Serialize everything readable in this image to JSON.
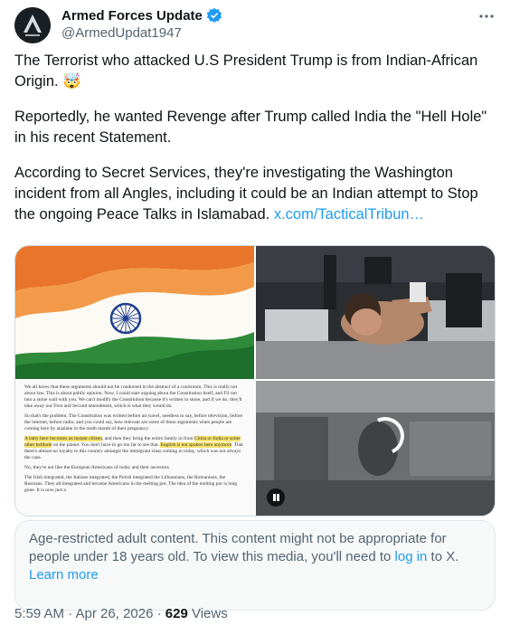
{
  "author": {
    "name": "Armed Forces Update",
    "handle": "@ArmedUpdat1947"
  },
  "tweet": {
    "paragraphs": [
      "The Terrorist who attacked U.S President Trump is from Indian-African Origin. 🤯",
      "Reportedly, he wanted Revenge after Trump called India the \"Hell Hole\" in his recent Statement.",
      "According to Secret Services, they're investigating the Washington incident from all Angles, including it could be an Indian attempt to Stop the ongoing Peace Talks in Islamabad. "
    ],
    "link": "x.com/TacticalTribun…"
  },
  "media_doc": {
    "p1": "We all know that these arguments should not be conducted in the abstract of a courtroom. This is really not about law. This is about public opinion. Now, I could start arguing about the Constitution itself, and I'll run into a stone wall with you. We can't modify the Constitution because it's written in stone, and if we do, they'll take away our First and Second amendment, which is what they would do.",
    "p2": "So that's the problem. The Constitution was written before air travel, needless to say, before television, before the internet, before radio, and you could say, how relevant are some of these arguments when people are coming here by airplane in the ninth month of their pregnancy.",
    "p3a": "A baby here becomes an instant citizen",
    "p3b": ", and then they bring the entire family in from ",
    "p3c": "China or India or some other hellhole",
    "p3d": " on the planet. You don't have to go too far to see that. ",
    "p3e": "English is not spoken here anymore",
    "p3f": ". That there's almost no loyalty to this country amongst the immigrant class coming in today, which was not always the case.",
    "p4": "No, they're not like the European Americans of today and their ancestors.",
    "p5": "The Irish integrated, the Italians integrated, the Polish integrated the Lithuanians, the Romanians, the Russians. They all integrated and became Americans in the melting pot. The idea of the melting pot is long gone. It is now just a"
  },
  "warning": {
    "text_before": "Age-restricted adult content. This content might not be appropriate for people under 18 years old. To view this media, you'll need to ",
    "login_link": "log in",
    "text_middle": " to X. ",
    "learn_more": "Learn more"
  },
  "meta": {
    "timestamp": "5:59 AM · Apr 26, 2026 · ",
    "views_count": "629",
    "views_label": " Views"
  },
  "colors": {
    "accent": "#1d9bf0",
    "verified": "#1d9bf0",
    "muted_text": "#536471"
  }
}
